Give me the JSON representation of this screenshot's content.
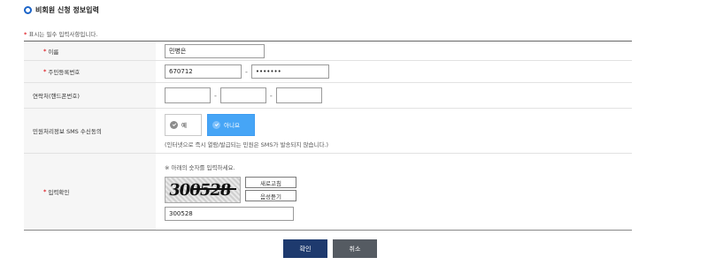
{
  "section_title": "비회원 신청 정보입력",
  "required_note": "표시는 필수 입력사항입니다.",
  "required_mark": "*",
  "rows": {
    "name": {
      "label": "이름",
      "value": "민병은"
    },
    "rrn": {
      "label": "주민등록번호",
      "front": "670712",
      "back": "•••••••"
    },
    "phone": {
      "label": "연락처(핸드폰번호)",
      "p1": "",
      "p2": "",
      "p3": ""
    },
    "sms": {
      "label": "민원처리정보 SMS 수신동의",
      "yes_label": "예",
      "no_label": "아니요",
      "selected": "no",
      "note": "(인터넷으로 즉시 열람/발급되는 민원은 SMS가 발송되지 않습니다.)"
    },
    "captcha": {
      "label": "입력확인",
      "hint": "※ 아래의 숫자를 입력하세요.",
      "image_text": "300528",
      "refresh_label": "새로고침",
      "audio_label": "음성듣기",
      "value": "300528"
    }
  },
  "dash": "-",
  "buttons": {
    "confirm": "확인",
    "cancel": "취소"
  },
  "colors": {
    "accent": "#1b64c8",
    "required": "#e0262d",
    "toggle_selected": "#46a5f6",
    "confirm": "#1e3a6e",
    "cancel": "#555b62"
  }
}
